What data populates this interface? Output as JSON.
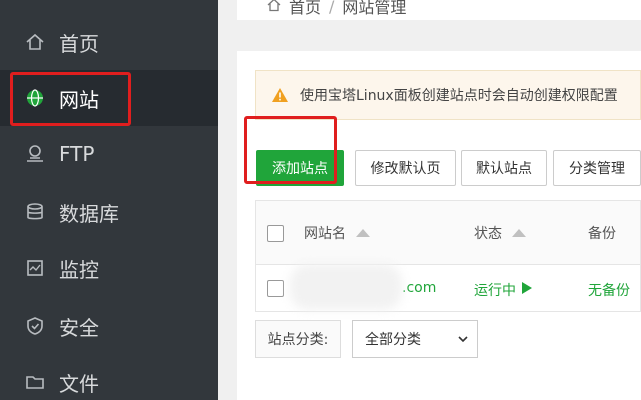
{
  "sidebar": {
    "items": [
      {
        "label": "首页",
        "icon": "home-icon"
      },
      {
        "label": "网站",
        "icon": "globe-icon",
        "active": true
      },
      {
        "label": "FTP",
        "icon": "ftp-icon"
      },
      {
        "label": "数据库",
        "icon": "database-icon"
      },
      {
        "label": "监控",
        "icon": "monitor-icon"
      },
      {
        "label": "安全",
        "icon": "shield-icon"
      },
      {
        "label": "文件",
        "icon": "folder-icon"
      }
    ]
  },
  "breadcrumb": {
    "home": "首页",
    "separator": "/",
    "current": "网站管理"
  },
  "notice": {
    "text": "使用宝塔Linux面板创建站点时会自动创建权限配置"
  },
  "toolbar": {
    "add_site": "添加站点",
    "edit_default_page": "修改默认页",
    "default_site": "默认站点",
    "category_manage": "分类管理"
  },
  "table": {
    "headers": {
      "name": "网站名",
      "status": "状态",
      "backup": "备份"
    },
    "rows": [
      {
        "name": ".com",
        "status": "运行中",
        "backup": "无备份"
      }
    ]
  },
  "filter": {
    "label": "站点分类:",
    "selected": "全部分类"
  },
  "colors": {
    "sidebar": "#32373c",
    "primary": "#20a53a",
    "highlight": "#e01e1e",
    "warning": "#f0a020"
  }
}
